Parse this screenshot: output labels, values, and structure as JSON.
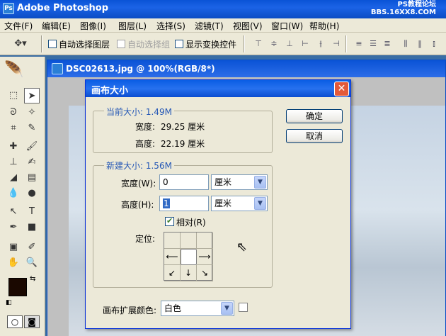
{
  "app": {
    "title": "Adobe Photoshop",
    "logo": "Ps"
  },
  "watermark": {
    "line1": "PS教程论坛",
    "line2": "BBS.16XX8.COM"
  },
  "menubar": {
    "items": [
      "文件(F)",
      "编辑(E)",
      "图像(I)",
      "图层(L)",
      "选择(S)",
      "滤镜(T)",
      "视图(V)",
      "窗口(W)",
      "帮助(H)"
    ]
  },
  "options": {
    "auto_select_layer": "自动选择图层",
    "auto_select_group": "自动选择组",
    "show_transform": "显示变换控件"
  },
  "document": {
    "title": "DSC02613.jpg @ 100%(RGB/8*)"
  },
  "dialog": {
    "title": "画布大小",
    "current": {
      "header": "当前大小: 1.49M",
      "width_label": "宽度:",
      "width_value": "29.25 厘米",
      "height_label": "高度:",
      "height_value": "22.19 厘米"
    },
    "new": {
      "header": "新建大小: 1.56M",
      "width_label": "宽度(W):",
      "width_value": "0",
      "width_unit": "厘米",
      "height_label": "高度(H):",
      "height_value": "1",
      "height_unit": "厘米",
      "relative_label": "相对(R)",
      "relative_checked": true,
      "anchor_label": "定位:"
    },
    "ok": "确定",
    "cancel": "取消",
    "extension_label": "画布扩展颜色:",
    "extension_value": "白色",
    "extension_color": "#ffffff"
  },
  "colors": {
    "titlebar": "#0a53d6",
    "dialog_accent": "#2356b5",
    "foreground": "#1a0800",
    "background": "#ffffff"
  }
}
